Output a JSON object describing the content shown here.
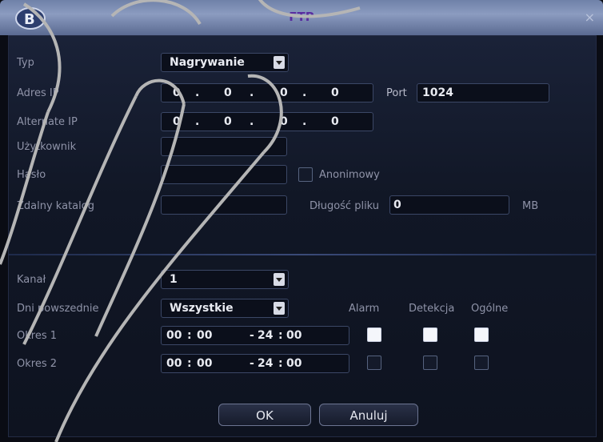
{
  "window": {
    "title": "FTP",
    "close_glyph": "×"
  },
  "form": {
    "type_label": "Typ",
    "type_value": "Nagrywanie",
    "ip_label": "Adres IP",
    "ip": [
      "0",
      "0",
      "0",
      "0"
    ],
    "port_label": "Port",
    "port_value": "1024",
    "alt_ip_label": "Alternate IP",
    "alt_ip": [
      "0",
      "0",
      "0",
      "0"
    ],
    "user_label": "Użytkownik",
    "user_value": "",
    "pass_label": "Hasło",
    "pass_value": "",
    "anon_label": "Anonimowy",
    "dir_label": "Zdalny katalog",
    "dir_value": "",
    "file_len_label": "Długość pliku",
    "file_len_value": "0",
    "file_len_unit": "MB"
  },
  "schedule": {
    "channel_label": "Kanał",
    "channel_value": "1",
    "weekday_label": "Dni powszednie",
    "weekday_value": "Wszystkie",
    "col_alarm": "Alarm",
    "col_detection": "Detekcja",
    "col_general": "Ogólne",
    "periods": [
      {
        "label": "Okres 1",
        "start_h": "00",
        "start_m": "00",
        "end_h": "24",
        "end_m": "00",
        "alarm": true,
        "detection": true,
        "general": true
      },
      {
        "label": "Okres 2",
        "start_h": "00",
        "start_m": "00",
        "end_h": "24",
        "end_m": "00",
        "alarm": false,
        "detection": false,
        "general": false
      }
    ]
  },
  "buttons": {
    "ok": "OK",
    "cancel": "Anuluj"
  }
}
